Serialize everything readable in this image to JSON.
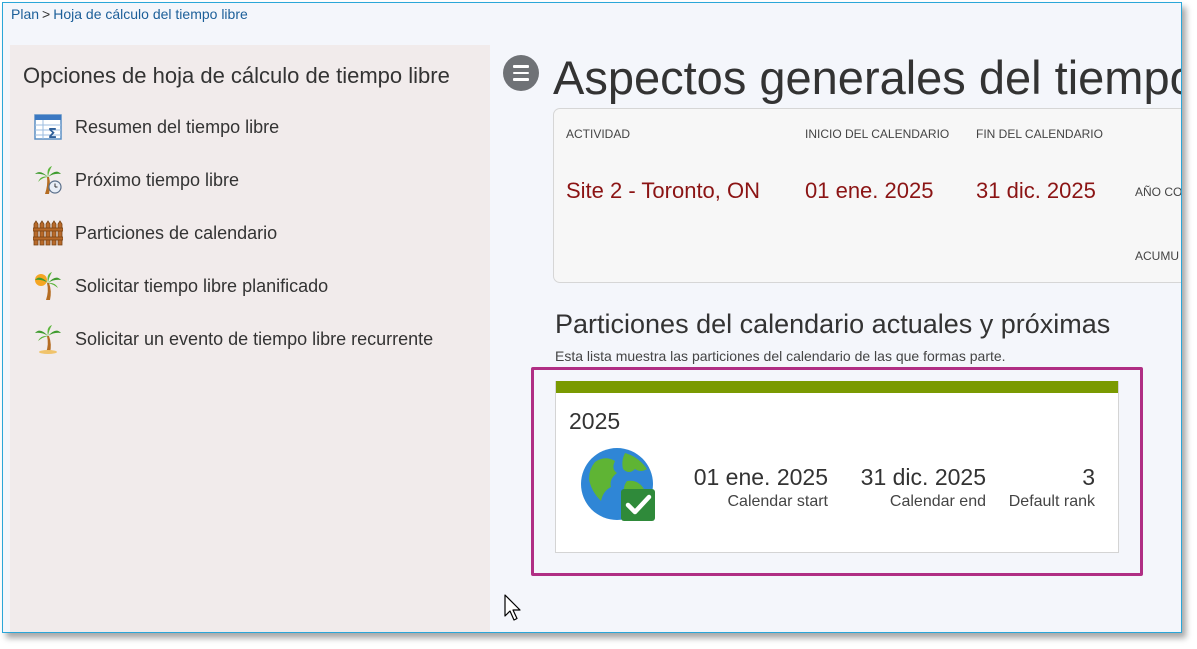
{
  "breadcrumb": {
    "root": "Plan",
    "separator": ">",
    "current": "Hoja de cálculo del tiempo libre"
  },
  "sidebar": {
    "title": "Opciones de hoja de cálculo de tiempo libre",
    "items": [
      {
        "label": "Resumen del tiempo libre",
        "icon": "spreadsheet-sum-icon"
      },
      {
        "label": "Próximo tiempo libre",
        "icon": "palm-tree-clock-icon"
      },
      {
        "label": "Particiones de calendario",
        "icon": "fence-icon"
      },
      {
        "label": "Solicitar tiempo libre planificado",
        "icon": "palm-tree-icon"
      },
      {
        "label": "Solicitar un evento de tiempo libre recurrente",
        "icon": "palm-tree-icon"
      }
    ]
  },
  "main": {
    "title": "Aspectos generales del tiempo libre",
    "info": {
      "headers": [
        "ACTIVIDAD",
        "INICIO DEL CALENDARIO",
        "FIN DEL CALENDARIO"
      ],
      "values": [
        "Site 2 - Toronto, ON",
        "01 ene. 2025",
        "31 dic. 2025"
      ],
      "extra_label_1": "AÑO CO",
      "extra_label_2": "ACUMU"
    },
    "partitions": {
      "title": "Particiones del calendario actuales y próximas",
      "subtitle": "Esta lista muestra las particiones del calendario de las que formas parte.",
      "card": {
        "year": "2025",
        "start_value": "01 ene. 2025",
        "start_label": "Calendar start",
        "end_value": "31 dic. 2025",
        "end_label": "Calendar end",
        "rank_value": "3",
        "rank_label": "Default rank",
        "icon": "globe-check-icon",
        "bar_color": "#7a9a01"
      }
    }
  },
  "colors": {
    "accent_value": "#8b1414",
    "highlight_border": "#b02e84",
    "link": "#1c5f99"
  }
}
